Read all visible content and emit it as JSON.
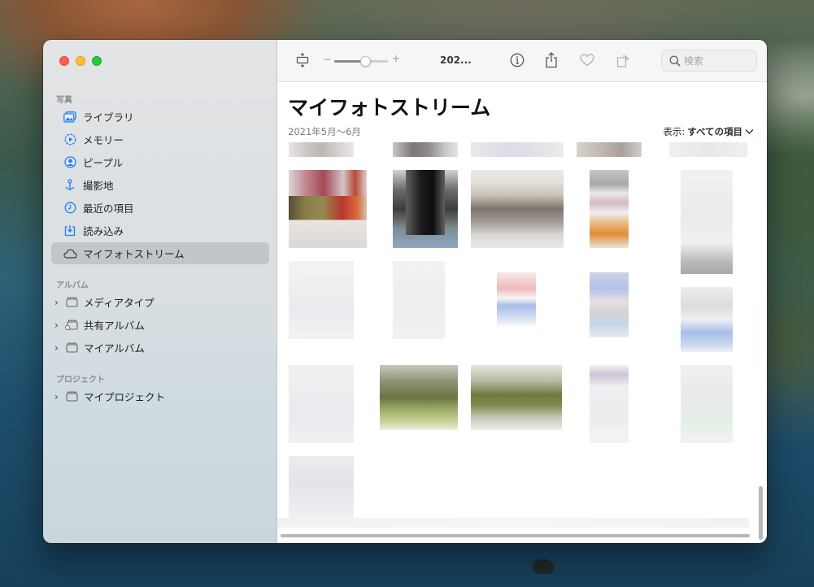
{
  "sidebar": {
    "sections": [
      {
        "label": "写真"
      },
      {
        "label": "アルバム"
      },
      {
        "label": "プロジェクト"
      }
    ],
    "library_items": [
      {
        "label": "ライブラリ",
        "icon": "photo-library-icon"
      },
      {
        "label": "メモリー",
        "icon": "memories-icon"
      },
      {
        "label": "ピープル",
        "icon": "people-icon"
      },
      {
        "label": "撮影地",
        "icon": "places-icon"
      },
      {
        "label": "最近の項目",
        "icon": "recents-icon"
      },
      {
        "label": "読み込み",
        "icon": "imports-icon"
      },
      {
        "label": "マイフォトストリーム",
        "icon": "cloud-icon",
        "selected": true
      }
    ],
    "album_items": [
      {
        "label": "メディアタイプ",
        "icon": "folder-icon"
      },
      {
        "label": "共有アルバム",
        "icon": "shared-folder-icon"
      },
      {
        "label": "マイアルバム",
        "icon": "folder-icon"
      }
    ],
    "project_items": [
      {
        "label": "マイプロジェクト",
        "icon": "folder-icon"
      }
    ]
  },
  "toolbar": {
    "title": "202...",
    "zoom_minus": "−",
    "zoom_plus": "+",
    "zoom_level": 0.6,
    "search_placeholder": "検索"
  },
  "main": {
    "title": "マイフォトストリーム",
    "date_range": "2021年5月〜6月",
    "view_filter_label": "表示:",
    "view_filter_value": "すべての項目"
  },
  "colors": {
    "accent": "#007aff",
    "selected_row": "#c2c6ca"
  }
}
